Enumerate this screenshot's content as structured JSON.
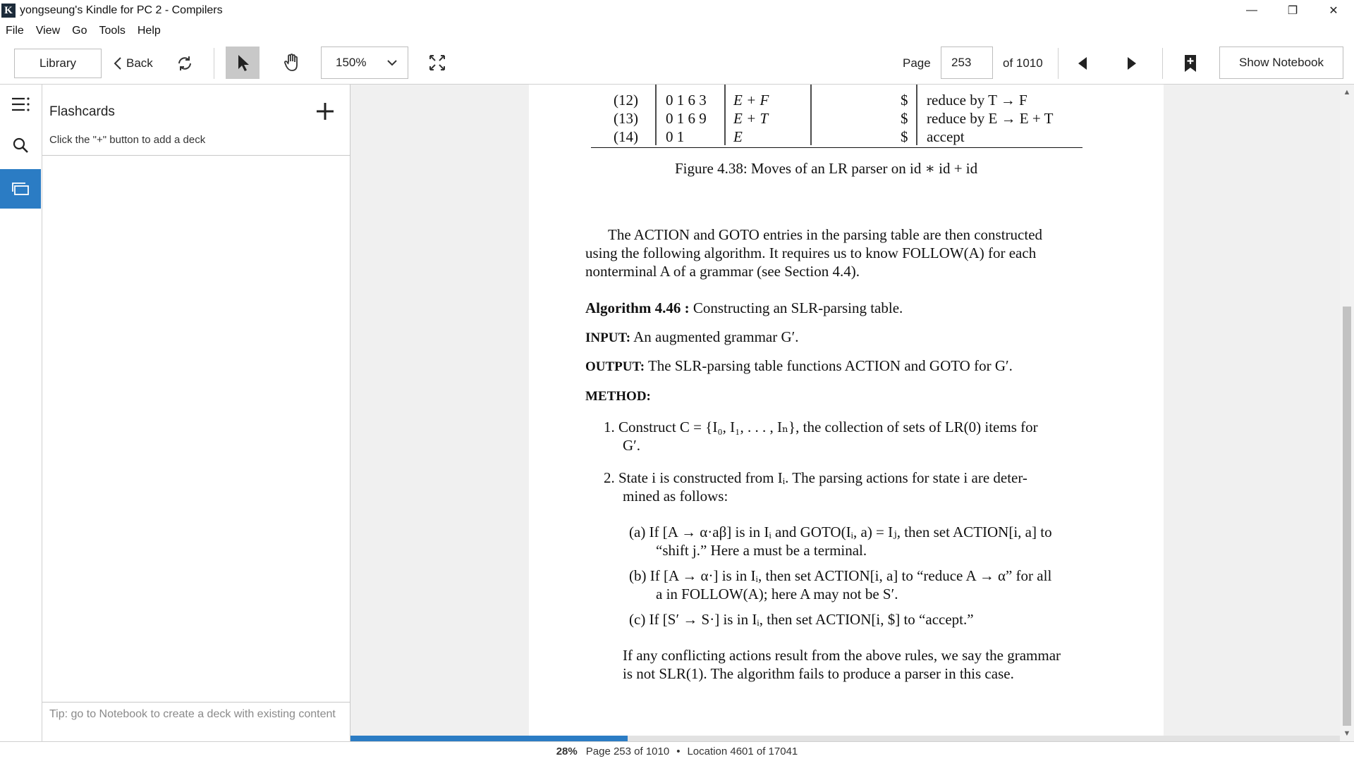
{
  "window": {
    "title": "yongseung's Kindle for PC 2 - Compilers",
    "app_icon_glyph": "K",
    "minimize_glyph": "—",
    "maximize_glyph": "❐",
    "close_glyph": "✕"
  },
  "menu": [
    "File",
    "View",
    "Go",
    "Tools",
    "Help"
  ],
  "toolbar": {
    "library_label": "Library",
    "back_label": "Back",
    "zoom_value": "150%",
    "page_label": "Page",
    "page_value": "253",
    "page_of": "of 1010",
    "show_notebook_label": "Show Notebook"
  },
  "panel": {
    "title": "Flashcards",
    "hint": "Click the \"+\" button to add a deck",
    "tip": "Tip: go to Notebook to create a deck with existing content"
  },
  "book": {
    "table_rows": [
      {
        "step": "(12)",
        "stack": "0 1 6 3",
        "symbols": "E + F",
        "input": "$",
        "action": "reduce by T → F"
      },
      {
        "step": "(13)",
        "stack": "0 1 6 9",
        "symbols": "E + T",
        "input": "$",
        "action": "reduce by E → E + T"
      },
      {
        "step": "(14)",
        "stack": "0 1",
        "symbols": "E",
        "input": "$",
        "action": "accept"
      }
    ],
    "caption": "Figure 4.38: Moves of an LR parser on id ∗ id + id",
    "para1": [
      "The ACTION and GOTO entries in the parsing table are then constructed",
      "using the following algorithm.  It requires us to know FOLLOW(A) for each",
      "nonterminal A of a grammar (see Section 4.4)."
    ],
    "algo_head": "Algorithm 4.46 :",
    "algo_title": "Constructing an SLR-parsing table.",
    "input_head": "INPUT:",
    "input_text": "An augmented grammar G′.",
    "output_head": "OUTPUT:",
    "output_text": "The SLR-parsing table functions ACTION and GOTO for G′.",
    "method_head": "METHOD:",
    "step1": [
      "1.  Construct C = {I₀, I₁, . . . , Iₙ}, the collection of sets of LR(0) items for",
      "G′."
    ],
    "step2": [
      "2.  State i is constructed from Iᵢ.  The parsing actions for state i are deter-",
      "mined as follows:"
    ],
    "step2a": [
      "(a)  If [A → α·aβ] is in Iᵢ and GOTO(Iᵢ, a) = Iⱼ, then set ACTION[i, a] to",
      "“shift j.”  Here a must be a terminal."
    ],
    "step2b": [
      "(b)  If [A → α·] is in Iᵢ, then set ACTION[i, a] to “reduce A → α” for all",
      "a in FOLLOW(A); here A may not be S′."
    ],
    "step2c": [
      "(c)  If [S′ → S·] is in Iᵢ, then set ACTION[i, $] to “accept.”"
    ],
    "para2": [
      "If any conflicting actions result from the above rules, we say the grammar",
      "is not SLR(1).  The algorithm fails to produce a parser in this case."
    ]
  },
  "status": {
    "percent": "28%",
    "page_text": "Page 253 of 1010",
    "separator": "•",
    "location_text": "Location 4601 of 17041",
    "progress_fraction": 0.28
  },
  "colors": {
    "accent": "#2b7cc4",
    "selected_tool": "#c8c8c8"
  }
}
